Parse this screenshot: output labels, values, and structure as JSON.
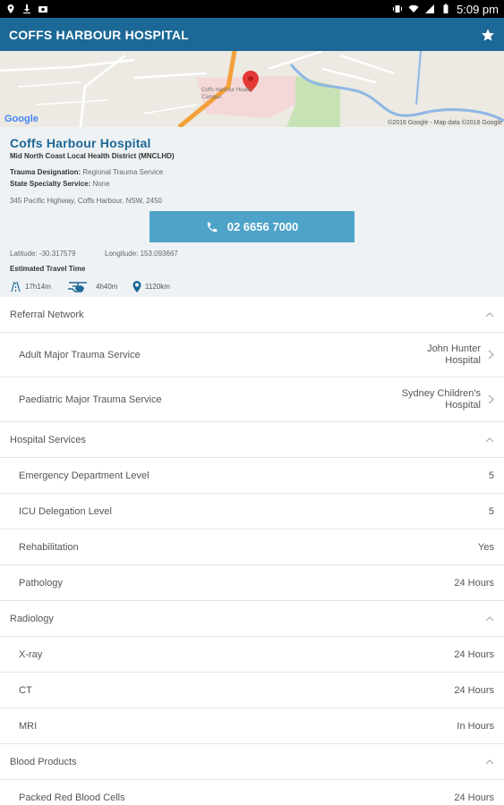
{
  "status_bar": {
    "time": "5:09 pm"
  },
  "app_bar": {
    "title": "COFFS HARBOUR HOSPITAL"
  },
  "map": {
    "attribution": "©2016 Google - Map data ©2016 Google",
    "google_logo": "Google",
    "pin_label": "Coffs Harbour Health Campus"
  },
  "hospital": {
    "name": "Coffs Harbour Hospital",
    "district": "Mid North Coast Local Health District (MNCLHD)",
    "trauma_label": "Trauma Designation:",
    "trauma_value": "Regional Trauma Service",
    "specialty_label": "State Specialty Service:",
    "specialty_value": "None",
    "address": "345 Pacific Highway, Coffs Harbour, NSW, 2450",
    "phone": "02 6656 7000",
    "latitude": "Latitude: -30.317579",
    "longitude": "Longitude: 153.093667",
    "travel_title": "Estimated Travel Time",
    "travel_road": "17h14m",
    "travel_air": "4h40m",
    "travel_distance": "1120km"
  },
  "sections": {
    "referral": {
      "title": "Referral Network",
      "items": [
        {
          "label": "Adult Major Trauma Service",
          "value": [
            "John Hunter",
            "Hospital"
          ]
        },
        {
          "label": "Paediatric Major Trauma Service",
          "value": [
            "Sydney Children's",
            "Hospital"
          ]
        }
      ]
    },
    "services": {
      "title": "Hospital Services",
      "items": [
        {
          "label": "Emergency Department Level",
          "value": "5"
        },
        {
          "label": "ICU Delegation Level",
          "value": "5"
        },
        {
          "label": "Rehabilitation",
          "value": "Yes"
        },
        {
          "label": "Pathology",
          "value": "24 Hours"
        }
      ]
    },
    "radiology": {
      "title": "Radiology",
      "items": [
        {
          "label": "X-ray",
          "value": "24 Hours"
        },
        {
          "label": "CT",
          "value": "24 Hours"
        },
        {
          "label": "MRI",
          "value": "In Hours"
        }
      ]
    },
    "blood": {
      "title": "Blood Products",
      "items": [
        {
          "label": "Packed Red Blood Cells",
          "value": "24 Hours"
        }
      ]
    }
  },
  "colors": {
    "primary": "#1c6896",
    "call_button": "#4ea3c8",
    "info_bg": "#eef2f4"
  }
}
